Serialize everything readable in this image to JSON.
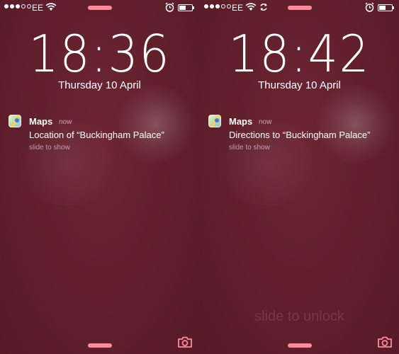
{
  "colors": {
    "accent": "#ff8a9a",
    "background": "#5e1c28"
  },
  "screens": [
    {
      "status": {
        "carrier": "EE",
        "signal_full": 3,
        "signal_empty": 2,
        "sync_icon": false,
        "battery_level": 0.55
      },
      "time": "18:36",
      "date": "Thursday 10 April",
      "notification": {
        "app": "Maps",
        "time": "now",
        "message": "Location of “Buckingham Palace”",
        "hint": "slide to show"
      },
      "unlock_text": ""
    },
    {
      "status": {
        "carrier": "EE",
        "signal_full": 3,
        "signal_empty": 2,
        "sync_icon": true,
        "battery_level": 0.55
      },
      "time": "18:42",
      "date": "Thursday 10 April",
      "notification": {
        "app": "Maps",
        "time": "now",
        "message": "Directions to “Buckingham Palace”",
        "hint": "slide to show"
      },
      "unlock_text": "slide to unlock"
    }
  ],
  "icons": {
    "wifi": "wifi-icon",
    "alarm": "alarm-icon",
    "battery": "battery-icon",
    "camera": "camera-icon",
    "sync": "sync-icon",
    "app": "maps-icon"
  }
}
